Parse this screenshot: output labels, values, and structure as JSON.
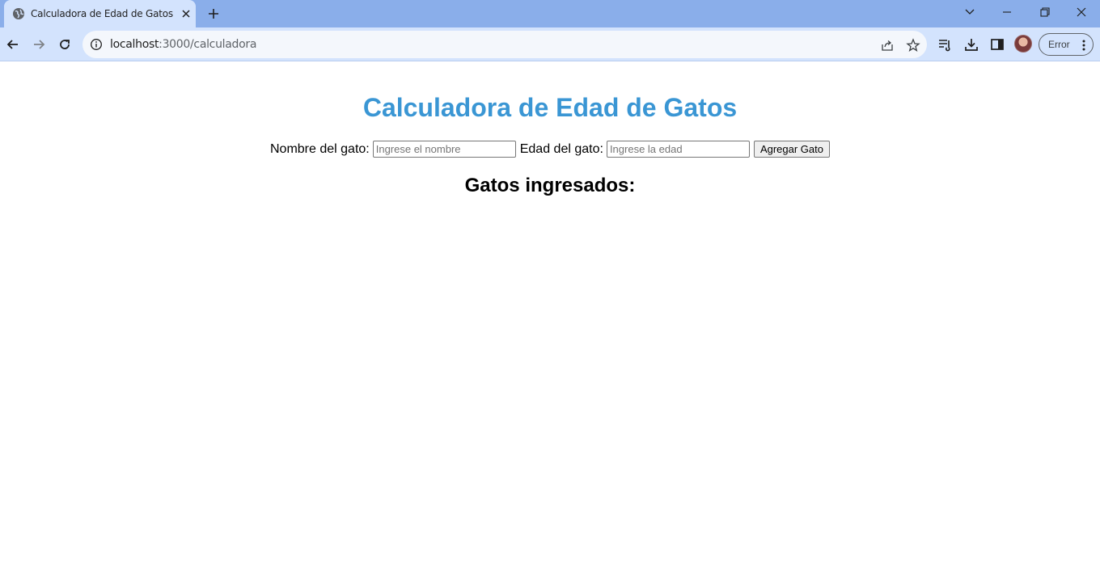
{
  "browser": {
    "tab_title": "Calculadora de Edad de Gatos",
    "url_host": "localhost",
    "url_path": ":3000/calculadora",
    "profile_status": "Error"
  },
  "page": {
    "title": "Calculadora de Edad de Gatos",
    "name_label": "Nombre del gato:",
    "name_placeholder": "Ingrese el nombre",
    "name_value": "",
    "age_label": "Edad del gato:",
    "age_placeholder": "Ingrese la edad",
    "age_value": "",
    "add_button": "Agregar Gato",
    "list_heading": "Gatos ingresados:"
  },
  "colors": {
    "title_blue": "#3a96d4",
    "tabbar_bg": "#8aaeea",
    "toolbar_bg": "#d3e3fd"
  },
  "icons": [
    "globe-icon",
    "close-icon",
    "plus-icon",
    "chevron-down-icon",
    "minimize-icon",
    "restore-icon",
    "window-close-icon",
    "back-arrow-icon",
    "forward-arrow-icon",
    "reload-icon",
    "info-icon",
    "share-icon",
    "star-icon",
    "reading-list-icon",
    "download-icon",
    "side-panel-icon",
    "avatar",
    "kebab-menu-icon"
  ]
}
